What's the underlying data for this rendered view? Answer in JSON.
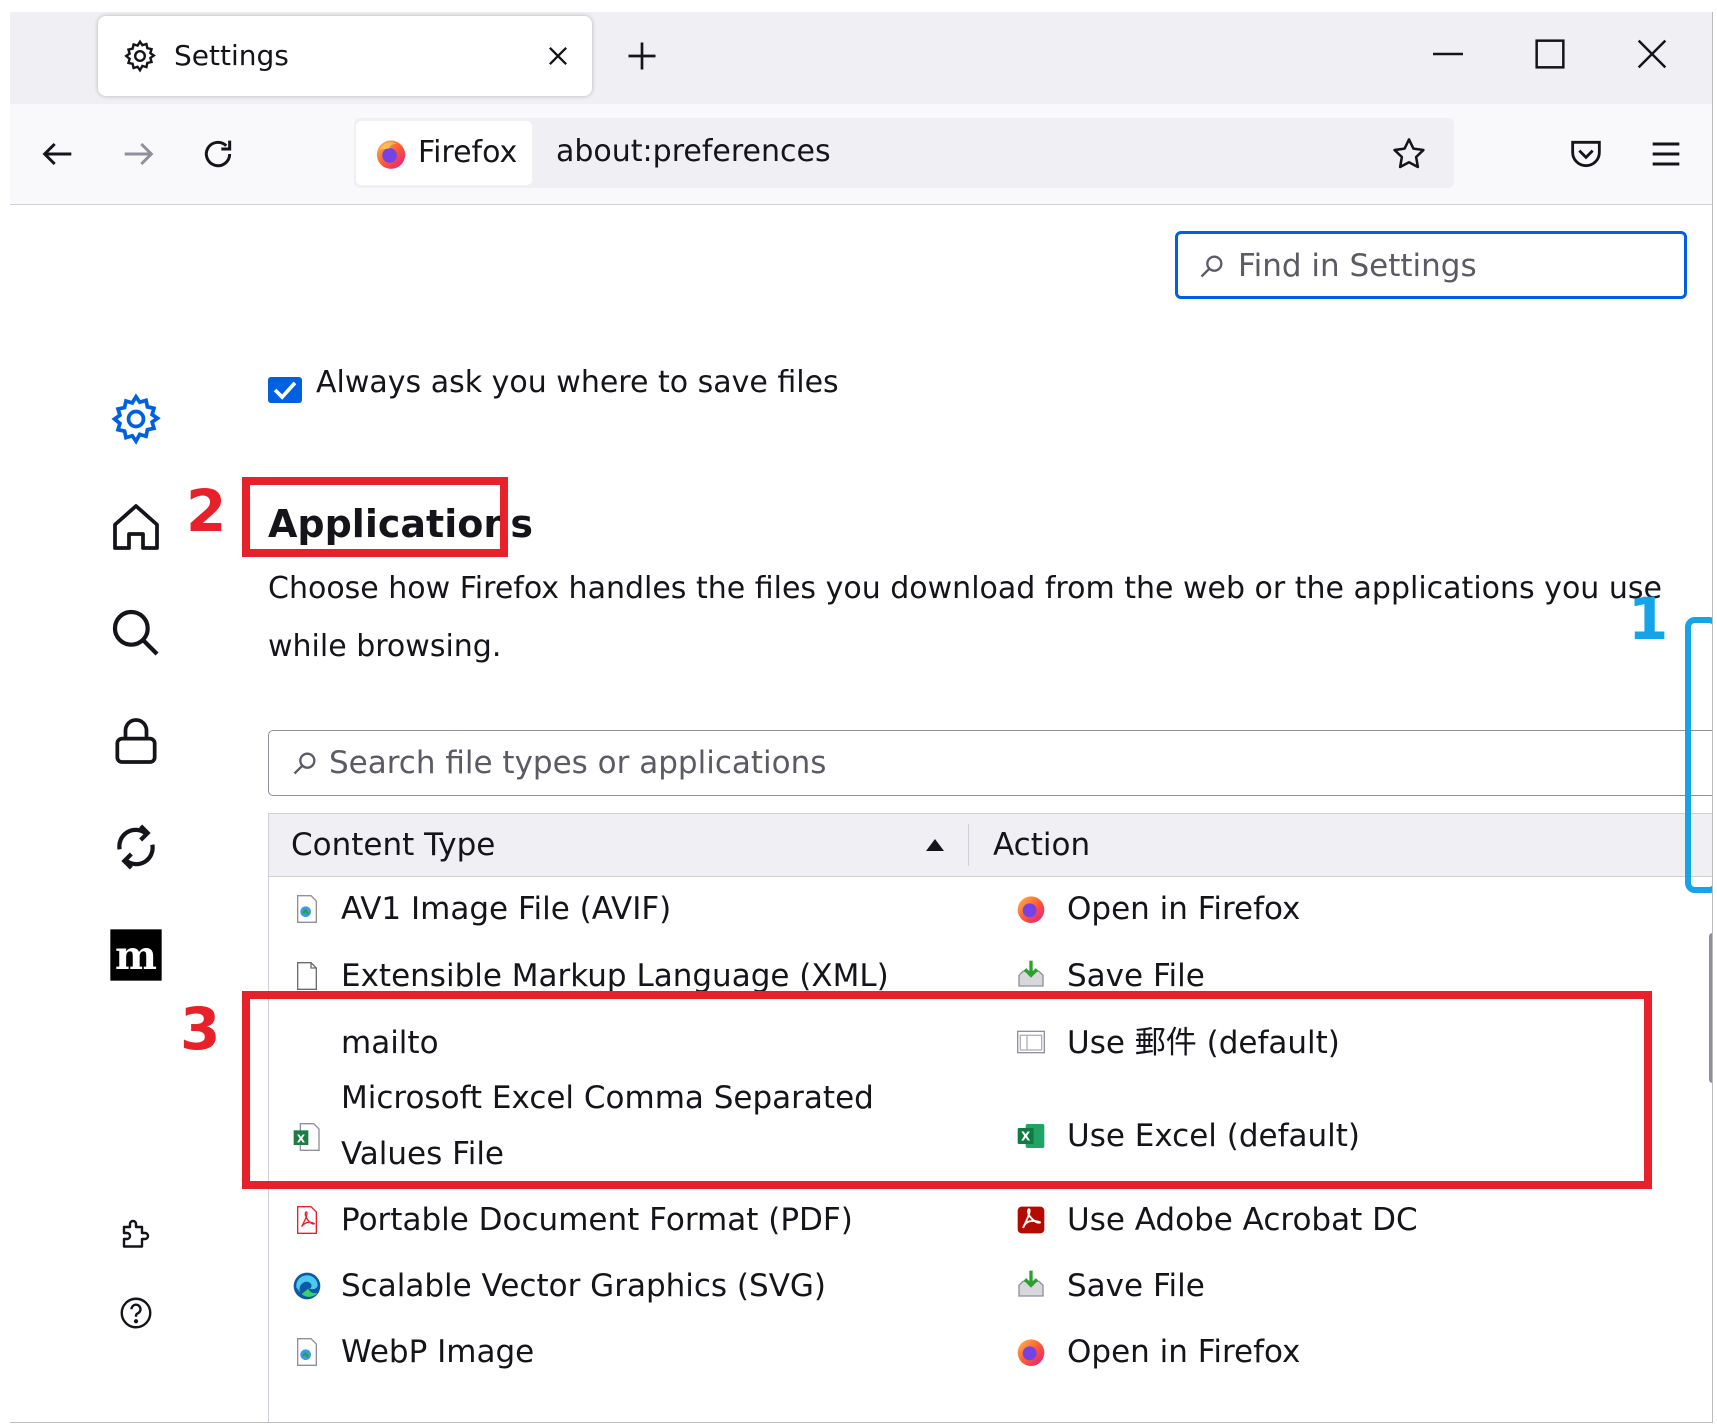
{
  "tabs": [
    {
      "label": "Settings",
      "icon": "gear-icon"
    }
  ],
  "urlbar": {
    "identity_label": "Firefox",
    "url": "about:preferences"
  },
  "search": {
    "placeholder": "Find in Settings"
  },
  "sidebar": {
    "items": [
      {
        "icon": "gear-icon",
        "name": "General",
        "active": true
      },
      {
        "icon": "home-icon",
        "name": "Home"
      },
      {
        "icon": "search-icon",
        "name": "Search"
      },
      {
        "icon": "lock-icon",
        "name": "Privacy & Security"
      },
      {
        "icon": "sync-icon",
        "name": "Sync"
      },
      {
        "icon": "mozilla-m-icon",
        "name": "More from Mozilla"
      },
      {
        "icon": "puzzle-icon",
        "name": "Extensions & Themes"
      },
      {
        "icon": "help-icon",
        "name": "Support"
      }
    ]
  },
  "downloads": {
    "always_ask_label": "Always ask you where to save files",
    "always_ask_checked": true
  },
  "applications": {
    "title": "Applications",
    "description": "Choose how Firefox handles the files you download from the web or the applications you use while browsing.",
    "search_placeholder": "Search file types or applications",
    "columns": [
      "Content Type",
      "Action"
    ],
    "rows": [
      {
        "type": "AV1 Image File (AVIF)",
        "type_icon": "image-file-icon",
        "action": "Open in Firefox",
        "action_icon": "firefox-icon"
      },
      {
        "type": "Extensible Markup Language (XML)",
        "type_icon": "blank-file-icon",
        "action": "Save File",
        "action_icon": "save-file-icon"
      },
      {
        "type": "mailto",
        "type_icon": "",
        "action": "Use 郵件 (default)",
        "action_icon": "mail-app-icon"
      },
      {
        "type": "Microsoft Excel Comma Separated Values File",
        "type_icon": "excel-file-icon",
        "action": "Use Excel (default)",
        "action_icon": "excel-icon"
      },
      {
        "type": "Portable Document Format (PDF)",
        "type_icon": "pdf-file-icon",
        "action": "Use Adobe Acrobat DC",
        "action_icon": "acrobat-icon"
      },
      {
        "type": "Scalable Vector Graphics (SVG)",
        "type_icon": "edge-icon",
        "action": "Save File",
        "action_icon": "save-file-icon"
      },
      {
        "type": "WebP Image",
        "type_icon": "image-file-icon",
        "action": "Open in Firefox",
        "action_icon": "firefox-icon"
      }
    ]
  },
  "annotations": [
    "1",
    "2",
    "3"
  ],
  "colors": {
    "accent": "#0061e0",
    "annotation_red": "#e8202a",
    "annotation_blue": "#16a4e8"
  }
}
